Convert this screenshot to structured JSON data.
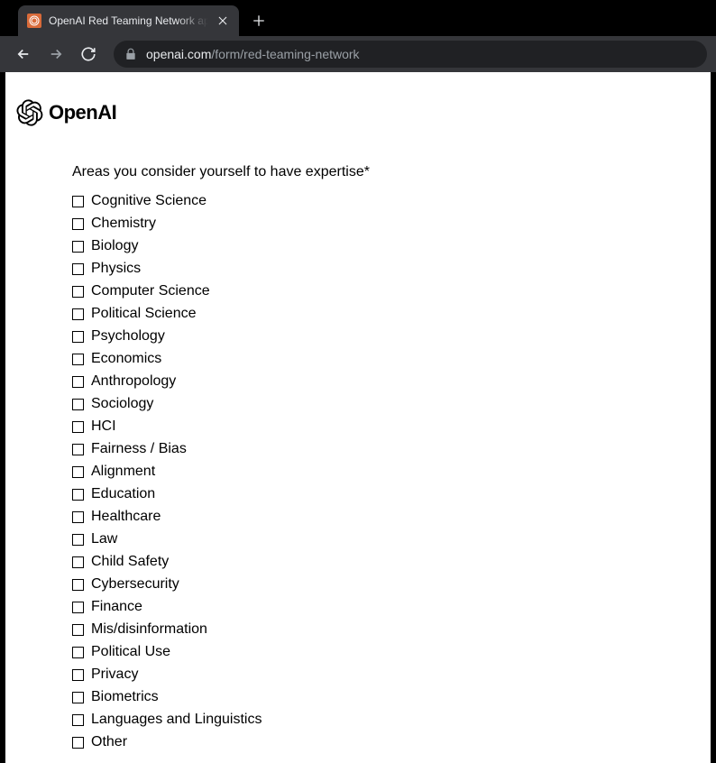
{
  "browser": {
    "tab_title": "OpenAI Red Teaming Network ap",
    "url_domain": "openai.com",
    "url_path": "/form/red-teaming-network"
  },
  "page": {
    "brand": "OpenAI",
    "form_label": "Areas you consider yourself to have expertise*",
    "expertise_options": [
      "Cognitive Science",
      "Chemistry",
      "Biology",
      "Physics",
      "Computer Science",
      "Political Science",
      "Psychology",
      "Economics",
      "Anthropology",
      "Sociology",
      "HCI",
      "Fairness / Bias",
      "Alignment",
      "Education",
      "Healthcare",
      "Law",
      "Child Safety",
      "Cybersecurity",
      "Finance",
      "Mis/disinformation",
      "Political Use",
      "Privacy",
      "Biometrics",
      "Languages and Linguistics",
      "Other"
    ]
  }
}
